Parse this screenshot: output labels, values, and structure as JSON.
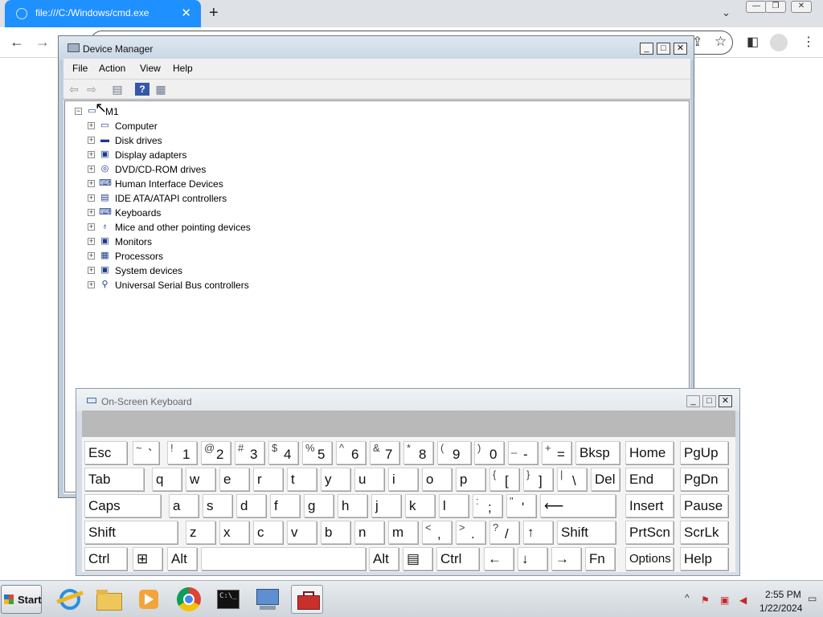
{
  "browser": {
    "tab_title": "file:///C:/Windows/cmd.exe",
    "tab_close": "✕",
    "new_tab": "+",
    "tab_list_icon": "chevron-down-icon",
    "minimize": "—",
    "restore": "❐",
    "close": "✕",
    "back_icon": "arrow-left-icon",
    "forward_icon": "arrow-right-icon"
  },
  "device_manager": {
    "title": "Device Manager",
    "window_buttons": {
      "minimize": "_",
      "maximize": "□",
      "close": "✕"
    },
    "menu": [
      "File",
      "Action",
      "View",
      "Help"
    ],
    "toolbar_icons": [
      "back-icon",
      "forward-icon",
      "properties-icon",
      "help-icon",
      "view-icon"
    ],
    "root": "M1",
    "nodes": [
      {
        "label": "Computer",
        "icon": "computer-icon"
      },
      {
        "label": "Disk drives",
        "icon": "disk-drive-icon"
      },
      {
        "label": "Display adapters",
        "icon": "display-adapter-icon"
      },
      {
        "label": "DVD/CD-ROM drives",
        "icon": "dvd-drive-icon"
      },
      {
        "label": "Human Interface Devices",
        "icon": "hid-icon"
      },
      {
        "label": "IDE ATA/ATAPI controllers",
        "icon": "ide-controller-icon"
      },
      {
        "label": "Keyboards",
        "icon": "keyboard-icon"
      },
      {
        "label": "Mice and other pointing devices",
        "icon": "mouse-icon"
      },
      {
        "label": "Monitors",
        "icon": "monitor-icon"
      },
      {
        "label": "Processors",
        "icon": "processor-icon"
      },
      {
        "label": "System devices",
        "icon": "system-devices-icon"
      },
      {
        "label": "Universal Serial Bus controllers",
        "icon": "usb-icon"
      }
    ]
  },
  "osk": {
    "title": "On-Screen Keyboard",
    "window_buttons": {
      "minimize": "_",
      "maximize": "□",
      "close": "✕"
    },
    "rows": [
      [
        {
          "t": "Esc"
        },
        {
          "s": "~",
          "b": "`"
        },
        {
          "s": "!",
          "b": "1"
        },
        {
          "s": "@",
          "b": "2"
        },
        {
          "s": "#",
          "b": "3"
        },
        {
          "s": "$",
          "b": "4"
        },
        {
          "s": "%",
          "b": "5"
        },
        {
          "s": "^",
          "b": "6"
        },
        {
          "s": "&",
          "b": "7"
        },
        {
          "s": "*",
          "b": "8"
        },
        {
          "s": "(",
          "b": "9"
        },
        {
          "s": ")",
          "b": "0"
        },
        {
          "s": "_",
          "b": "-"
        },
        {
          "s": "+",
          "b": "="
        },
        {
          "t": "Bksp"
        },
        {
          "t": "Home"
        },
        {
          "t": "PgUp"
        }
      ],
      [
        {
          "t": "Tab"
        },
        {
          "t": "q"
        },
        {
          "t": "w"
        },
        {
          "t": "e"
        },
        {
          "t": "r"
        },
        {
          "t": "t"
        },
        {
          "t": "y"
        },
        {
          "t": "u"
        },
        {
          "t": "i"
        },
        {
          "t": "o"
        },
        {
          "t": "p"
        },
        {
          "s": "{",
          "b": "["
        },
        {
          "s": "}",
          "b": "]"
        },
        {
          "s": "|",
          "b": "\\"
        },
        {
          "t": "Del"
        },
        {
          "t": "End"
        },
        {
          "t": "PgDn"
        }
      ],
      [
        {
          "t": "Caps"
        },
        {
          "t": "a"
        },
        {
          "t": "s"
        },
        {
          "t": "d"
        },
        {
          "t": "f"
        },
        {
          "t": "g"
        },
        {
          "t": "h"
        },
        {
          "t": "j"
        },
        {
          "t": "k"
        },
        {
          "t": "l"
        },
        {
          "s": ":",
          "b": ";"
        },
        {
          "s": "\"",
          "b": "'"
        },
        {
          "t": "⟵"
        },
        {
          "t": "Insert"
        },
        {
          "t": "Pause"
        }
      ],
      [
        {
          "t": "Shift"
        },
        {
          "t": "z"
        },
        {
          "t": "x"
        },
        {
          "t": "c"
        },
        {
          "t": "v"
        },
        {
          "t": "b"
        },
        {
          "t": "n"
        },
        {
          "t": "m"
        },
        {
          "s": "<",
          "b": ","
        },
        {
          "s": ">",
          "b": "."
        },
        {
          "s": "?",
          "b": "/"
        },
        {
          "t": "↑"
        },
        {
          "t": "Shift"
        },
        {
          "t": "PrtScn"
        },
        {
          "t": "ScrLk"
        }
      ],
      [
        {
          "t": "Ctrl"
        },
        {
          "t": "⊞"
        },
        {
          "t": "Alt"
        },
        {
          "t": ""
        },
        {
          "t": "Alt"
        },
        {
          "t": "▤"
        },
        {
          "t": "Ctrl"
        },
        {
          "t": "←"
        },
        {
          "t": "↓"
        },
        {
          "t": "→"
        },
        {
          "t": "Fn"
        },
        {
          "t": "Options"
        },
        {
          "t": "Help"
        }
      ]
    ]
  },
  "taskbar": {
    "start_label": "Start",
    "apps": [
      "internet-explorer-icon",
      "folder-icon",
      "media-player-icon",
      "chrome-icon",
      "cmd-icon",
      "remote-desktop-icon",
      "toolbox-icon"
    ],
    "tray_expand": "^",
    "time": "2:55 PM",
    "date": "1/22/2024"
  }
}
